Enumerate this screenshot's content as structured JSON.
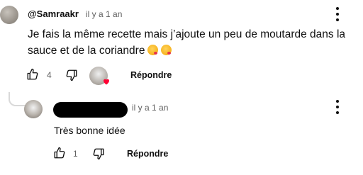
{
  "comment": {
    "author": "@Samraakr",
    "time": "il y a 1 an",
    "text": "Je fais la même recette mais j’ajoute un peu de moutarde dans la sauce et de la coriandre",
    "like_count": "4",
    "reply_label": "Répondre",
    "icons": [
      "more-vert-icon",
      "thumb-up-icon",
      "thumb-down-icon",
      "heart-icon",
      "emoji-kiss-icon"
    ]
  },
  "reply": {
    "time": "il y a 1 an",
    "text": "Très bonne idée",
    "like_count": "1",
    "reply_label": "Répondre",
    "author_redacted": true
  },
  "colors": {
    "heart": "#ff0033",
    "secondary_text": "#606060",
    "thread_line": "#d9d9d9"
  }
}
